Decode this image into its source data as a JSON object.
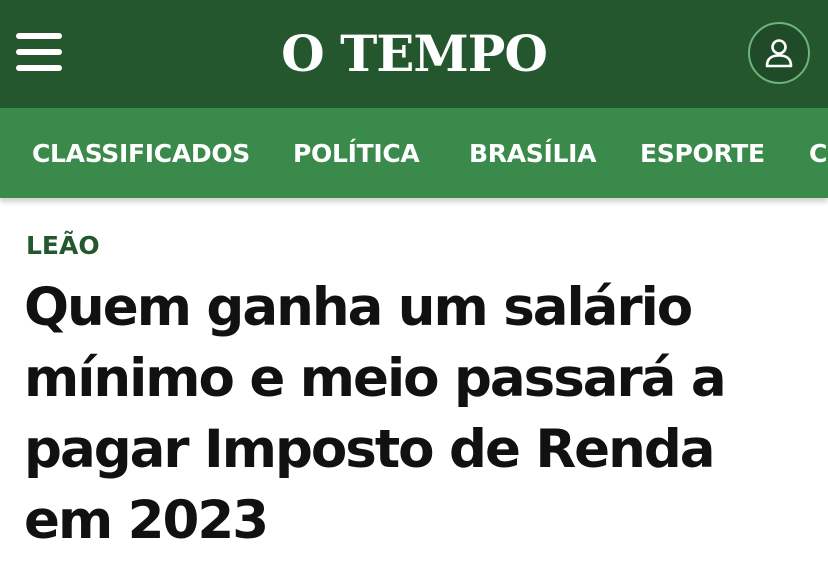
{
  "header": {
    "logo": "O TEMPO",
    "menu_icon": "hamburger-menu-icon",
    "user_icon": "user-icon"
  },
  "nav": {
    "items": [
      "CLASSIFICADOS",
      "POLÍTICA",
      "BRASÍLIA",
      "ESPORTE",
      "C"
    ]
  },
  "article": {
    "category": "LEÃO",
    "headline": "Quem ganha um salário mínimo e meio passará a pagar Imposto de Renda em 2023"
  },
  "colors": {
    "header_bg": "#25572f",
    "nav_bg": "#3a8a4c",
    "category_text": "#25572f",
    "headline_text": "#111111"
  }
}
